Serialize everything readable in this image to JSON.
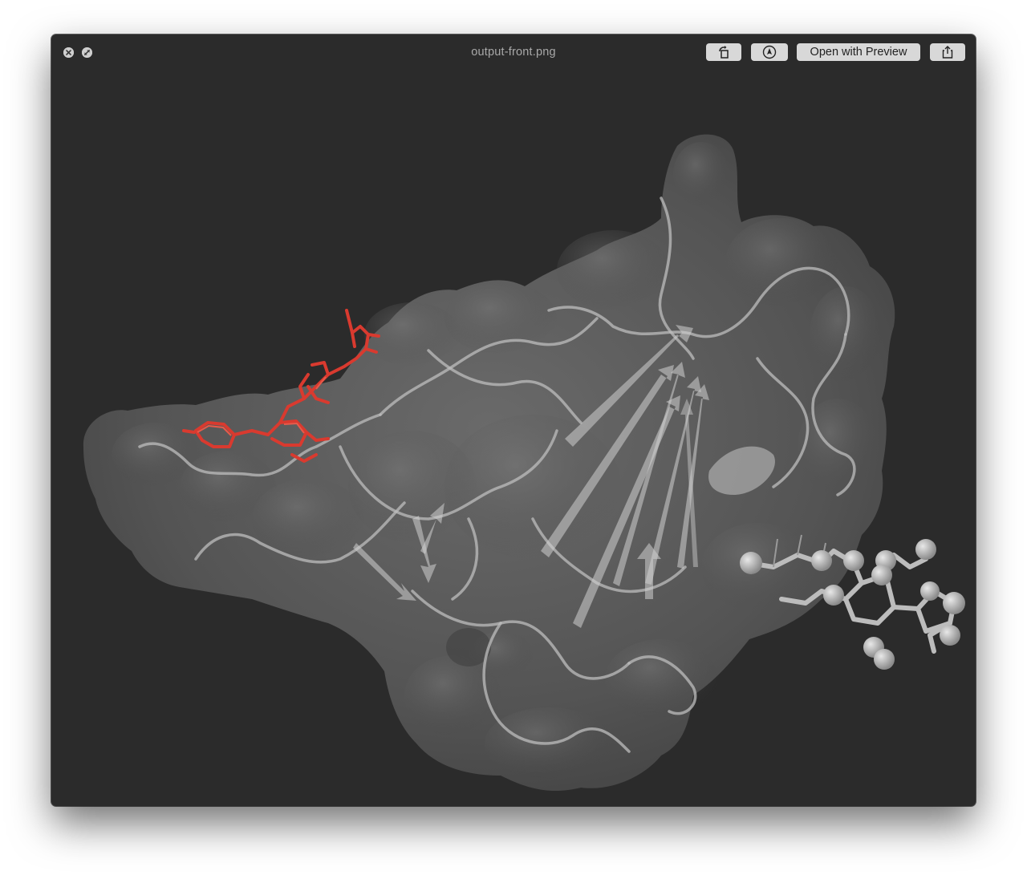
{
  "window": {
    "title": "output-front.png"
  },
  "toolbar": {
    "rotate_icon": "rotate-left-icon",
    "markup_icon": "markup-pen-icon",
    "open_with_label": "Open with Preview",
    "share_icon": "share-icon"
  },
  "titlebar_controls": {
    "close_icon": "close-icon",
    "fullscreen_icon": "fullscreen-icon"
  },
  "image": {
    "subject": "protein-surface-render",
    "ligand_highlight_color": "#d93a2f",
    "surface_color": "#5a5a5a",
    "background_color": "#2b2b2b"
  }
}
